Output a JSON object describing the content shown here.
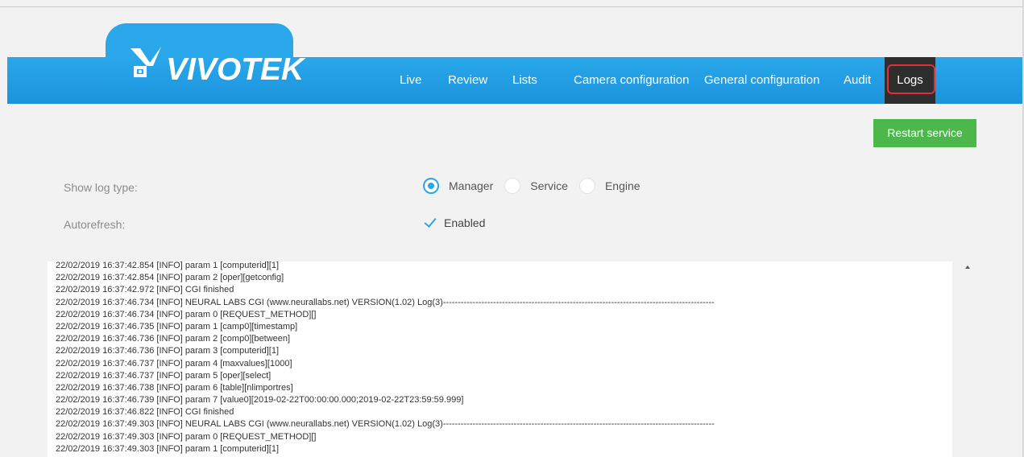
{
  "brand": {
    "logo_text": "VIVOTEK",
    "logo_icon": "vivotek-logo-icon"
  },
  "nav": {
    "items": [
      {
        "label": "Live"
      },
      {
        "label": "Review"
      },
      {
        "label": "Lists"
      },
      {
        "label": "Camera configuration"
      },
      {
        "label": "General configuration"
      },
      {
        "label": "Audit"
      },
      {
        "label": "Logs",
        "active": true
      }
    ]
  },
  "toolbar": {
    "restart_label": "Restart service"
  },
  "log_type": {
    "label": "Show log type:",
    "options": [
      "Manager",
      "Service",
      "Engine"
    ],
    "selected": "Manager"
  },
  "autorefresh": {
    "label": "Autorefresh:",
    "checkbox_label": "Enabled",
    "checked": true
  },
  "logs": {
    "lines": [
      "22/02/2019 16:37:42.854 [INFO] param 1 [computerid][1]",
      "22/02/2019 16:37:42.854 [INFO] param 2 [oper][getconfig]",
      "22/02/2019 16:37:42.972 [INFO] CGI finished",
      "22/02/2019 16:37:46.734 [INFO] NEURAL LABS CGI (www.neurallabs.net) VERSION(1.02) Log(3)--------------------------------------------------------------------------------------------",
      "22/02/2019 16:37:46.734 [INFO] param 0 [REQUEST_METHOD][]",
      "22/02/2019 16:37:46.735 [INFO] param 1 [camp0][timestamp]",
      "22/02/2019 16:37:46.736 [INFO] param 2 [comp0][between]",
      "22/02/2019 16:37:46.736 [INFO] param 3 [computerid][1]",
      "22/02/2019 16:37:46.737 [INFO] param 4 [maxvalues][1000]",
      "22/02/2019 16:37:46.737 [INFO] param 5 [oper][select]",
      "22/02/2019 16:37:46.738 [INFO] param 6 [table][nlimportres]",
      "22/02/2019 16:37:46.739 [INFO] param 7 [value0][2019-02-22T00:00:00.000;2019-02-22T23:59:59.999]",
      "22/02/2019 16:37:46.822 [INFO] CGI finished",
      "22/02/2019 16:37:49.303 [INFO] NEURAL LABS CGI (www.neurallabs.net) VERSION(1.02) Log(3)--------------------------------------------------------------------------------------------",
      "22/02/2019 16:37:49.303 [INFO] param 0 [REQUEST_METHOD][]",
      "22/02/2019 16:37:49.303 [INFO] param 1 [computerid][1]"
    ]
  },
  "colors": {
    "brand_blue": "#2aa7ea",
    "active_tab": "#2e2e2e",
    "active_outline": "#e0303a",
    "restart_green": "#4cb84c"
  }
}
